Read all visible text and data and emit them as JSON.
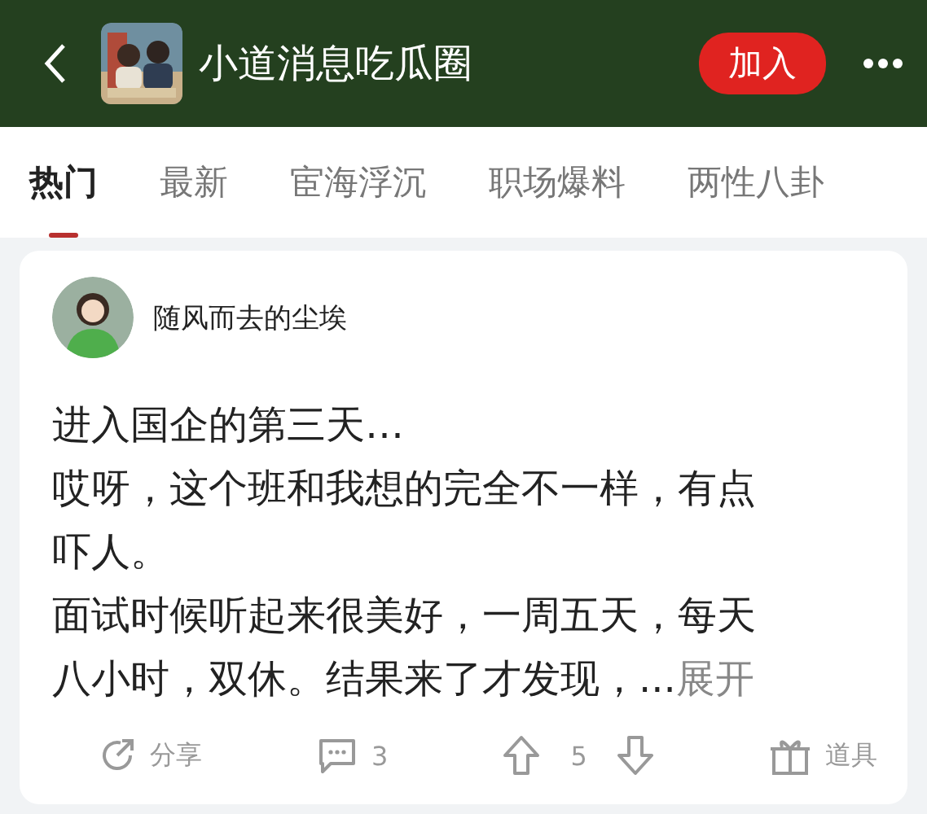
{
  "header": {
    "title": "小道消息吃瓜圈",
    "join_button": "加入"
  },
  "tabs": [
    {
      "label": "热门",
      "selected": true
    },
    {
      "label": "最新",
      "selected": false
    },
    {
      "label": "宦海浮沉",
      "selected": false
    },
    {
      "label": "职场爆料",
      "selected": false
    },
    {
      "label": "两性八卦",
      "selected": false
    }
  ],
  "post": {
    "author": "随风而去的尘埃",
    "paragraphs": [
      "进入国企的第三天…",
      "哎呀，这个班和我想的完全不一样，有点吓人。",
      "面试时候听起来很美好，一周五天，每天八小时，双休。结果来了才发现，..."
    ],
    "expand_link": "展开",
    "actions": {
      "share": "分享",
      "comments": "3",
      "votes": "5",
      "props": "道具"
    }
  }
}
